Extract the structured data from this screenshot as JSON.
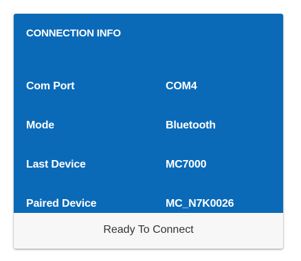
{
  "panel": {
    "title": "CONNECTION INFO",
    "rows": [
      {
        "label": "Com Port",
        "value": "COM4"
      },
      {
        "label": "Mode",
        "value": "Bluetooth"
      },
      {
        "label": "Last Device",
        "value": "MC7000"
      },
      {
        "label": "Paired Device",
        "value": "MC_N7K0026"
      }
    ]
  },
  "status": {
    "text": "Ready To Connect"
  },
  "colors": {
    "panel_background": "#0a6ab8",
    "panel_text": "#ffffff",
    "status_background": "#f7f7f7",
    "status_text": "#333333"
  }
}
